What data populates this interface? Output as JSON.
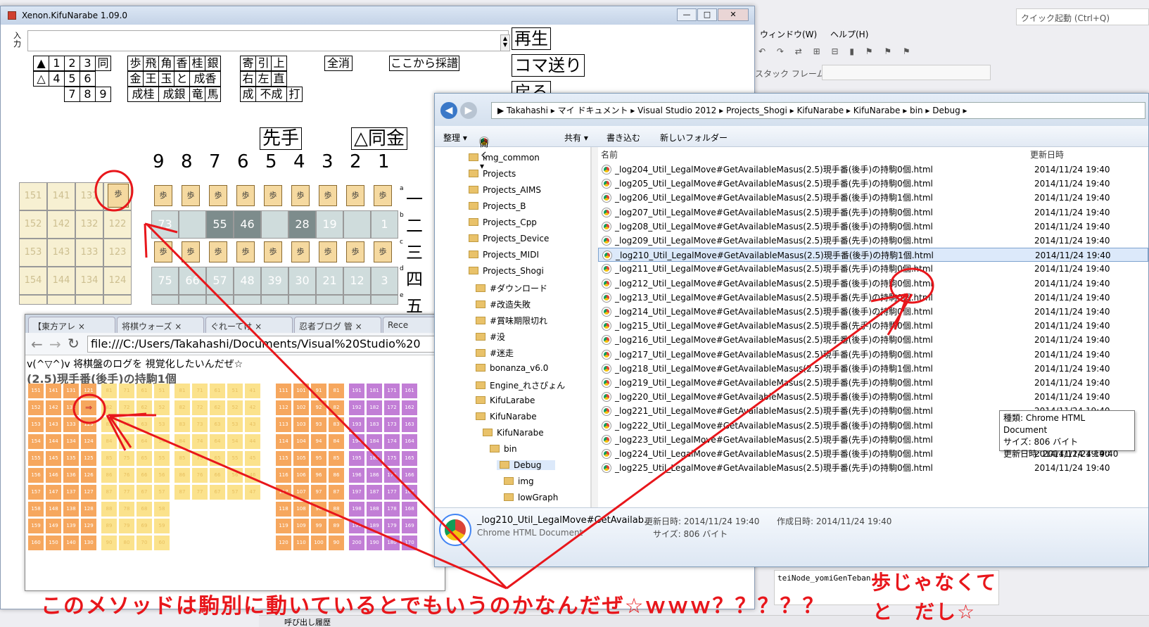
{
  "vs": {
    "quick_launch": "クイック起動 (Ctrl+Q)",
    "menu_window": "ウィンドウ(W)",
    "menu_help": "ヘルプ(H)",
    "stack_frame": "スタック フレーム",
    "output_text": "teiNode_yomiGenTeban",
    "call_history": "呼び出し履歴",
    "toolbar_icons": "↶ ↷ ⇄ ⊞ ⊟ ▮ ⚑ ⚑ ⚑"
  },
  "kifu": {
    "title": "Xenon.KifuNarabe 1.09.0",
    "input_label": "入力",
    "play_btn": "再生",
    "step_btn": "コマ送り",
    "back_btn": "戻る",
    "side_btns": [
      [
        "▲",
        "1",
        "2",
        "3",
        "同"
      ],
      [
        "△",
        "4",
        "5",
        "6"
      ],
      [
        "7",
        "8",
        "9"
      ]
    ],
    "piece_btns": [
      [
        "歩",
        "飛",
        "角",
        "香",
        "桂",
        "銀"
      ],
      [
        "金",
        "王",
        "玉",
        "と",
        "成香"
      ],
      [
        "成桂",
        "成銀",
        "竜",
        "馬"
      ]
    ],
    "move_btns": [
      [
        "寄",
        "引",
        "上"
      ],
      [
        "右",
        "左",
        "直"
      ],
      [
        "成",
        "不成",
        "打"
      ]
    ],
    "clear_all": "全消",
    "from_here": "ここから採譜",
    "sente": "先手",
    "last_move": "△同金",
    "col_nums": [
      "9",
      "8",
      "7",
      "6",
      "5",
      "4",
      "3",
      "2",
      "1"
    ],
    "row_nums": [
      "一",
      "二",
      "三",
      "四",
      "五"
    ],
    "hand_rows": [
      [
        "151",
        "141",
        "131"
      ],
      [
        "152",
        "142",
        "132",
        "122"
      ],
      [
        "153",
        "143",
        "133",
        "123"
      ],
      [
        "154",
        "144",
        "134",
        "124"
      ]
    ],
    "board_row2": [
      "73",
      "",
      "55",
      "46",
      "",
      "28",
      "19",
      "",
      "1"
    ],
    "board_row4": [
      "75",
      "66",
      "57",
      "48",
      "39",
      "30",
      "21",
      "12",
      "3"
    ],
    "board_row3_piece": "歩",
    "hand_piece": "歩",
    "row_letters": [
      "a",
      "b",
      "c",
      "d",
      "e"
    ]
  },
  "chrome": {
    "tabs": [
      "【東方アレ",
      "将棋ウォーズ",
      "ぐれーてけ",
      "忍者ブログ 管",
      "Rece"
    ],
    "url": "file:///C:/Users/Takahashi/Documents/Visual%20Studio%20",
    "line1": "v(^▽^)v 将棋盤のログを 視覚化したいんだぜ☆",
    "heading": "(2.5)現手番(後手)の持駒1個"
  },
  "explorer": {
    "crumbs": [
      "Takahashi",
      "マイ ドキュメント",
      "Visual Studio 2012",
      "Projects_Shogi",
      "KifuNarabe",
      "KifuNarabe",
      "bin",
      "Debug"
    ],
    "cmd": [
      "整理 ▾",
      "開く ▾",
      "共有 ▾",
      "書き込む",
      "新しいフォルダー"
    ],
    "nav": [
      "img_common",
      "Projects",
      "Projects_AIMS",
      "Projects_B",
      "Projects_Cpp",
      "Projects_Device",
      "Projects_MIDI",
      "Projects_Shogi",
      "#ダウンロード",
      "#改造失敗",
      "#賞味期限切れ",
      "#没",
      "#迷走",
      "bonanza_v6.0",
      "Engine_れさぴょん",
      "KifuLarabe",
      "KifuNarabe",
      "KifuNarabe",
      "bin",
      "Debug",
      "img",
      "lowGraph"
    ],
    "col_name": "名前",
    "col_date": "更新日時",
    "files": [
      [
        "_log204_Util_LegalMove#GetAvailableMasus(2.5)現手番(後手)の持駒0個.html",
        "2014/11/24 19:40"
      ],
      [
        "_log205_Util_LegalMove#GetAvailableMasus(2.5)現手番(先手)の持駒0個.html",
        "2014/11/24 19:40"
      ],
      [
        "_log206_Util_LegalMove#GetAvailableMasus(2.5)現手番(後手)の持駒1個.html",
        "2014/11/24 19:40"
      ],
      [
        "_log207_Util_LegalMove#GetAvailableMasus(2.5)現手番(先手)の持駒0個.html",
        "2014/11/24 19:40"
      ],
      [
        "_log208_Util_LegalMove#GetAvailableMasus(2.5)現手番(後手)の持駒0個.html",
        "2014/11/24 19:40"
      ],
      [
        "_log209_Util_LegalMove#GetAvailableMasus(2.5)現手番(先手)の持駒0個.html",
        "2014/11/24 19:40"
      ],
      [
        "_log210_Util_LegalMove#GetAvailableMasus(2.5)現手番(後手)の持駒1個.html",
        "2014/11/24 19:40"
      ],
      [
        "_log211_Util_LegalMove#GetAvailableMasus(2.5)現手番(先手)の持駒0個.html",
        "2014/11/24 19:40"
      ],
      [
        "_log212_Util_LegalMove#GetAvailableMasus(2.5)現手番(後手)の持駒0個.html",
        "2014/11/24 19:40"
      ],
      [
        "_log213_Util_LegalMove#GetAvailableMasus(2.5)現手番(先手)の持駒0個.html",
        "2014/11/24 19:40"
      ],
      [
        "_log214_Util_LegalMove#GetAvailableMasus(2.5)現手番(後手)の持駒0個.html",
        "2014/11/24 19:40"
      ],
      [
        "_log215_Util_LegalMove#GetAvailableMasus(2.5)現手番(先手)の持駒0個.html",
        "2014/11/24 19:40"
      ],
      [
        "_log216_Util_LegalMove#GetAvailableMasus(2.5)現手番(後手)の持駒0個.html",
        "2014/11/24 19:40"
      ],
      [
        "_log217_Util_LegalMove#GetAvailableMasus(2.5)現手番(先手)の持駒0個.html",
        "2014/11/24 19:40"
      ],
      [
        "_log218_Util_LegalMove#GetAvailableMasus(2.5)現手番(後手)の持駒1個.html",
        "2014/11/24 19:40"
      ],
      [
        "_log219_Util_LegalMove#GetAvailableMasus(2.5)現手番(先手)の持駒0個.html",
        "2014/11/24 19:40"
      ],
      [
        "_log220_Util_LegalMove#GetAvailableMasus(2.5)現手番(後手)の持駒0個.html",
        "2014/11/24 19:40"
      ],
      [
        "_log221_Util_LegalMove#GetAvailableMasus(2.5)現手番(先手)の持駒0個.html",
        "2014/11/24 19:40"
      ],
      [
        "_log222_Util_LegalMove#GetAvailableMasus(2.5)現手番(後手)の持駒0個.html",
        "2014/11/24 19:40"
      ],
      [
        "_log223_Util_LegalMove#GetAvailableMasus(2.5)現手番(先手)の持駒0個.html",
        "2014/11/24 19:40"
      ],
      [
        "_log224_Util_LegalMove#GetAvailableMasus(2.5)現手番(後手)の持駒0個.html",
        "2014/11/24 19:40"
      ],
      [
        "_log225_Util_LegalMove#GetAvailableMasus(2.5)現手番(先手)の持駒0個.html",
        "2014/11/24 19:40"
      ]
    ],
    "detail_name": "_log210_Util_LegalMove#GetAvailab...",
    "detail_type": "Chrome HTML Document",
    "detail_mod": "更新日時: 2014/11/24 19:40",
    "detail_size": "サイズ: 806 バイト",
    "detail_created": "作成日時: 2014/11/24 19:40",
    "tooltip": [
      "種類: Chrome HTML Document",
      "サイズ: 806 バイト",
      "更新日時: 2014/11/24 19:40"
    ]
  },
  "annotations": {
    "bottom_text": "このメソッドは駒別に動いているとでもいうのかなんだぜ☆ｗｗｗ？？？？？",
    "right_text_1": "歩じゃなくて",
    "right_text_2": "と　だし☆",
    "color": "#e8161b"
  }
}
